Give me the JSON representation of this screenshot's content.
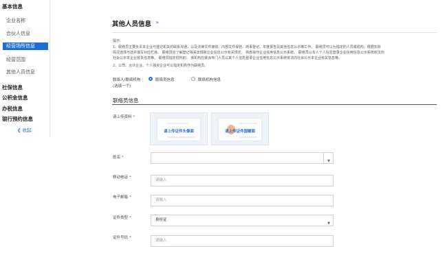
{
  "sidebar": {
    "groups": [
      {
        "label": "基本信息"
      },
      {
        "label": "企业名称"
      },
      {
        "label": "合伙人信息"
      },
      {
        "label": "经营场所信息"
      },
      {
        "label": "经营范围"
      },
      {
        "label": "其他人员信息"
      },
      {
        "label": "社保信息"
      },
      {
        "label": "公积金信息"
      },
      {
        "label": "办税信息"
      },
      {
        "label": "银行预约信息"
      }
    ],
    "collapse_label": "收起",
    "active_index": 3
  },
  "main": {
    "title": "其他人员信息",
    "notice": {
      "heading": "提示:",
      "line1": "1、联络员主要负责本企业与登记机关的联系沟通，以及法律文件接收、内部文件保管、商事登记、年度报告及其他信息公示等工作。 联络员可以为指定的人员或机构，根据实际",
      "line2": "情况选择与选并填写对应栏目。 联络员应了解登记相关法规和企业信息公示有关规定， 熟悉操作企业信用信息公示系统。 联络员以本人个人信息登录企业信用信息公示系统依法向",
      "line3": "社会公示本企业有关信息等。 联络员指定机构的， 该机构应委派专门人员以其个人信息登录企业信用信息公示系统依法向社会公示本企业有关信息等。",
      "line4": "2、公司、合伙企业、个人独资企业可以指定机构作为联络员。"
    },
    "contact_type": {
      "label_line1": "联络人/联络机构",
      "label_line2": "(选填一个)",
      "options": [
        "联络员信息",
        "联络机构信息"
      ],
      "selected": "联络员信息"
    },
    "section_title": "联络员信息",
    "fields": {
      "upload": {
        "label": "请上传资料",
        "front_btn": "请上传证件头像面",
        "back_btn": "请上传证件国徽面"
      },
      "name": {
        "label": "姓名",
        "value": ""
      },
      "phone": {
        "label": "移动电话",
        "placeholder": "请输入"
      },
      "email": {
        "label": "电子邮箱",
        "placeholder": "请输入"
      },
      "id_type": {
        "label": "证件类型",
        "value": "身份证"
      },
      "id_number": {
        "label": "证件号码",
        "placeholder": "请输入"
      }
    }
  },
  "colors": {
    "accent": "#1e6fd0",
    "required": "#e0322f"
  }
}
